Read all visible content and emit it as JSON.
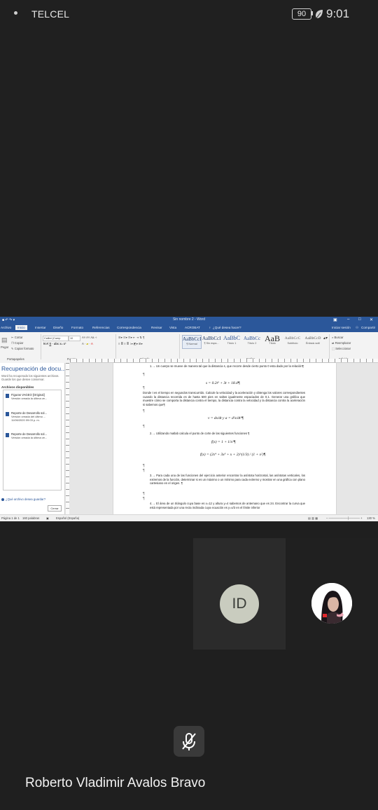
{
  "status_bar": {
    "carrier": "TELCEL",
    "battery": "90",
    "time": "9:01"
  },
  "word": {
    "window_title": "Sin nombre 2 - Word",
    "tabs": [
      "Archivo",
      "Inicio",
      "Insertar",
      "Diseño",
      "Formato",
      "Referencias",
      "Correspondencia",
      "Revisar",
      "Vista",
      "ACROBAT"
    ],
    "active_tab": "Inicio",
    "tell_me": "¿Qué desea hacer?",
    "sign_in": "Iniciar sesión",
    "share": "Compartir",
    "ribbon": {
      "paste": "Pegar",
      "cut": "Cortar",
      "copy": "Copiar",
      "format_painter": "Copiar formato",
      "font_name": "Calibri (Cuerp",
      "font_size": "10",
      "groups": [
        "Portapapeles",
        "Fuente",
        "Párrafo",
        "Estilos",
        "Edición"
      ],
      "styles": [
        {
          "sample": "AaBbCcI",
          "name": "¶ Normal"
        },
        {
          "sample": "AaBbCcI",
          "name": "¶ Sin espa..."
        },
        {
          "sample": "AaBbC",
          "name": "Título 1"
        },
        {
          "sample": "AaBbCc",
          "name": "Título 2"
        },
        {
          "sample": "AaB",
          "name": "Título"
        },
        {
          "sample": "AaBbCcC",
          "name": "Subtítulo"
        },
        {
          "sample": "AaBbCcD",
          "name": "Énfasis sutil"
        }
      ],
      "find": "Buscar",
      "replace": "Reemplazar",
      "select": "Seleccionar"
    },
    "recovery_pane": {
      "title": "Recuperación de docu...",
      "description": "Word ha recuperado los siguientes archivos. Guarde los que desee conservar.",
      "available_label": "Archivos disponibles",
      "files": [
        {
          "name": "Figuras VAGEO [Original]",
          "desc": "Versión creada la última ve..."
        },
        {
          "name": "Reporte de Desarrollo sol...",
          "desc": "Versión creada del último ..."
        },
        {
          "name": "Reporte de Desarrollo sol...",
          "desc": "Versión creada la última ve..."
        }
      ],
      "file_date": "11/06/2020 09:03 p. m.",
      "help_link": "¿Qué archivo desea guardar?",
      "close_button": "Cerrar"
    },
    "document": {
      "p1": "1.→ Un cuerpo se mueve de manera tal que la distancia s, que recorre desde cierto punto 0 esta dado por la relación¶",
      "eq1": "s = 0.2t⁵ + 3t + 18.4¶",
      "p2": "Donde t es el tiempo en segundos transcurrido. Calcule la velocidad y la aceleración y obtenga los valores correspondientes cuando la distancia recorrida es de hasta 500 pies en saltos igualmente espaciados de 0.1. Generar una gráfica que muestre cómo se comporta la distancia contra el tiempo, la distancia contra la velocidad y la distancia contra la aceleración si sabemos que¶",
      "eq2": "v = ds/dt   y   a = d²s/dt²¶",
      "p3": "2.→ Utilizando matlab calcula el punto de corte de las siguientes funciones ¶",
      "eq3": "f(x) = 1 + 1/x²¶",
      "eq4": "f(x) = (2x⁴ + 3x³ + x + 2)^(1/3) / (1 + x²)¶",
      "p4": "3.→ Para cada una de las funciones del ejercicio anterior encontrar la asíntota horizontal, las asíntotas verticales, los extremos de la función, determinar si es un máximo o un mínimo para cada extremo y mostrar en una gráfica con plano cartesiano en el origen. ¶",
      "p5": "4.→ El área de un triángulo cuya base es x=12 y altura y=4 sabemos de antemano que es 24. Encontrar la curva que está representada por una recta inclinada cuya ecuación es y=x/3 en el límite inferior"
    },
    "statusbar": {
      "page": "Página 1 de 1",
      "words": "160 palabras",
      "language": "Español (España)",
      "zoom": "130 %"
    }
  },
  "participants": [
    {
      "initials": "ID"
    },
    {
      "photo": "profile-photo"
    }
  ],
  "caller_name": "Roberto Vladimir Avalos Bravo"
}
